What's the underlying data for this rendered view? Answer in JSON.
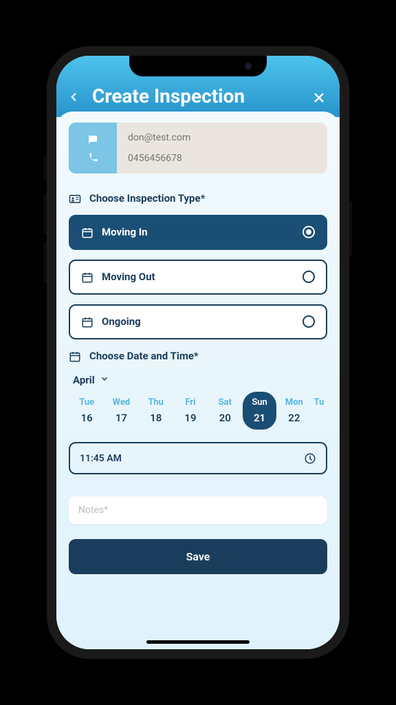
{
  "header": {
    "title": "Create Inspection"
  },
  "contact": {
    "email": "don@test.com",
    "phone": "0456456678"
  },
  "inspection_type": {
    "heading": "Choose Inspection Type*",
    "options": [
      {
        "label": "Moving In",
        "selected": true
      },
      {
        "label": "Moving Out",
        "selected": false
      },
      {
        "label": "Ongoing",
        "selected": false
      }
    ]
  },
  "date_time": {
    "heading": "Choose Date and Time*",
    "month": "April",
    "days": [
      {
        "name": "Tue",
        "date": "16",
        "selected": false
      },
      {
        "name": "Wed",
        "date": "17",
        "selected": false
      },
      {
        "name": "Thu",
        "date": "18",
        "selected": false
      },
      {
        "name": "Fri",
        "date": "19",
        "selected": false
      },
      {
        "name": "Sat",
        "date": "20",
        "selected": false
      },
      {
        "name": "Sun",
        "date": "21",
        "selected": true
      },
      {
        "name": "Mon",
        "date": "22",
        "selected": false
      },
      {
        "name": "Tu",
        "date": "",
        "selected": false,
        "partial": true
      }
    ],
    "time": "11:45 AM"
  },
  "notes": {
    "placeholder": "Notes*"
  },
  "buttons": {
    "save": "Save"
  }
}
